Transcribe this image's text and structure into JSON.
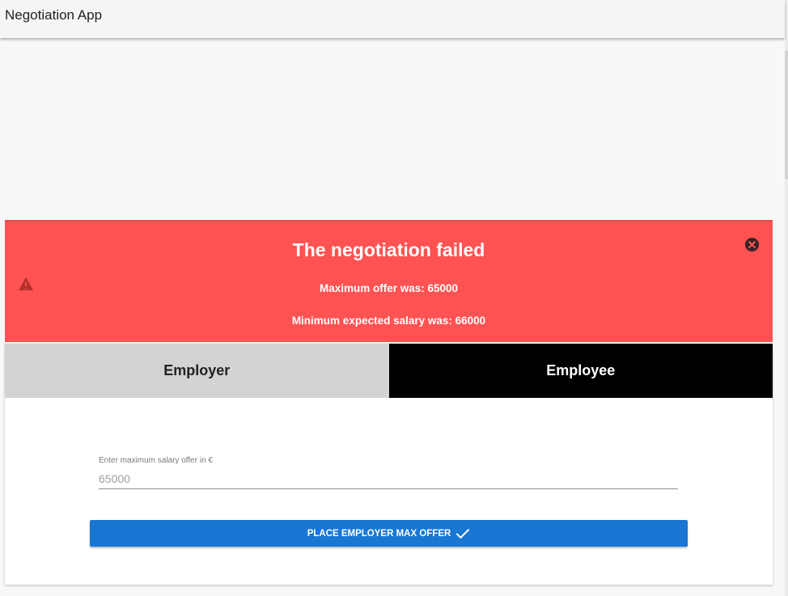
{
  "appbar": {
    "title": "Negotiation App"
  },
  "alert": {
    "title": "The negotiation failed",
    "line1": "Maximum offer was: 65000",
    "line2": "Minimum expected salary was: 66000",
    "warning_icon": "warning-triangle-icon",
    "close_icon": "close-circle-icon",
    "background_color": "#ff5252"
  },
  "tabs": [
    {
      "label": "Employer",
      "selected": false
    },
    {
      "label": "Employee",
      "selected": true
    }
  ],
  "form": {
    "field_label": "Enter maximum salary offer in €",
    "field_value": "65000",
    "submit_label": "PLACE EMPLOYER MAX OFFER",
    "submit_icon": "check-icon",
    "button_color": "#1976d2"
  }
}
